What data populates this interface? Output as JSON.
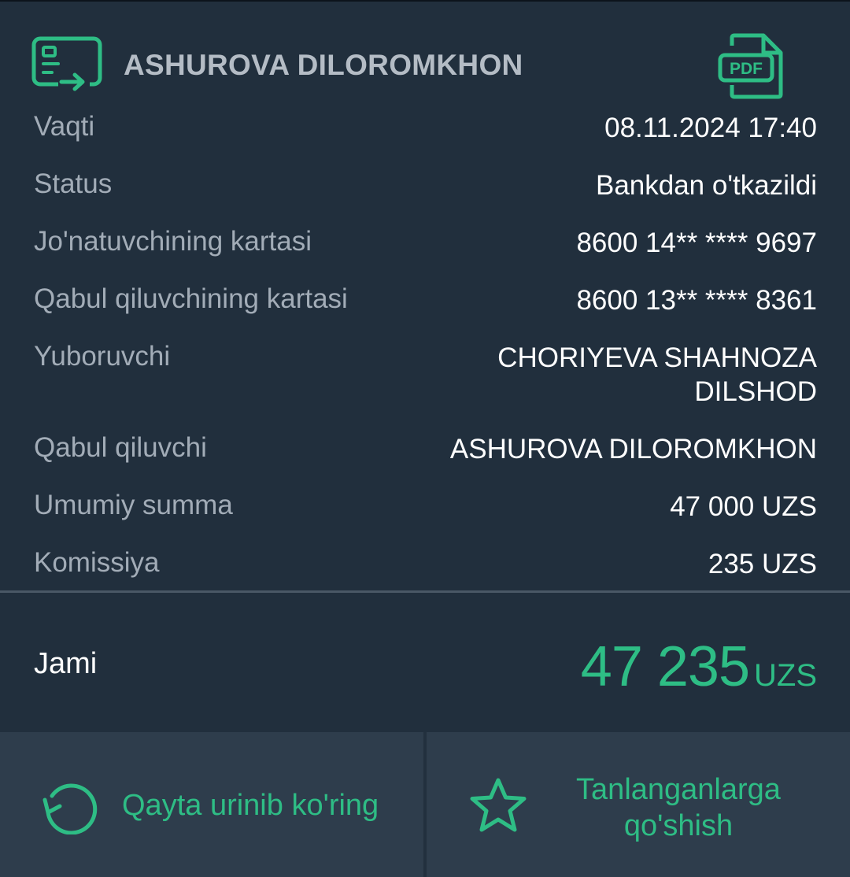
{
  "header": {
    "recipient_name": "ASHUROVA DILOROMKHON",
    "transfer_icon": "card-transfer-icon",
    "pdf_icon": "pdf-document-icon",
    "pdf_label": "PDF"
  },
  "details": [
    {
      "label": "Vaqti",
      "value": "08.11.2024 17:40"
    },
    {
      "label": "Status",
      "value": "Bankdan o'tkazildi"
    },
    {
      "label": "Jo'natuvchining kartasi",
      "value": "8600 14** **** 9697"
    },
    {
      "label": "Qabul qiluvchining kartasi",
      "value": "8600 13** **** 8361"
    },
    {
      "label": "Yuboruvchi",
      "value": "CHORIYEVA SHAHNOZA DILSHOD"
    },
    {
      "label": "Qabul qiluvchi",
      "value": "ASHUROVA DILOROMKHON"
    },
    {
      "label": "Umumiy summa",
      "value": "47 000 UZS"
    },
    {
      "label": "Komissiya",
      "value": "235 UZS"
    }
  ],
  "total": {
    "label": "Jami",
    "amount": "47 235",
    "currency": "UZS"
  },
  "actions": {
    "retry_label": "Qayta urinib ko'ring",
    "retry_icon": "retry-icon",
    "favorite_label": "Tanlanganlarga qo'shish",
    "favorite_icon": "star-icon"
  },
  "colors": {
    "background": "#212f3d",
    "accent": "#2ebd85",
    "label_text": "#a2acb7",
    "actions_background": "#2e3d4c"
  }
}
